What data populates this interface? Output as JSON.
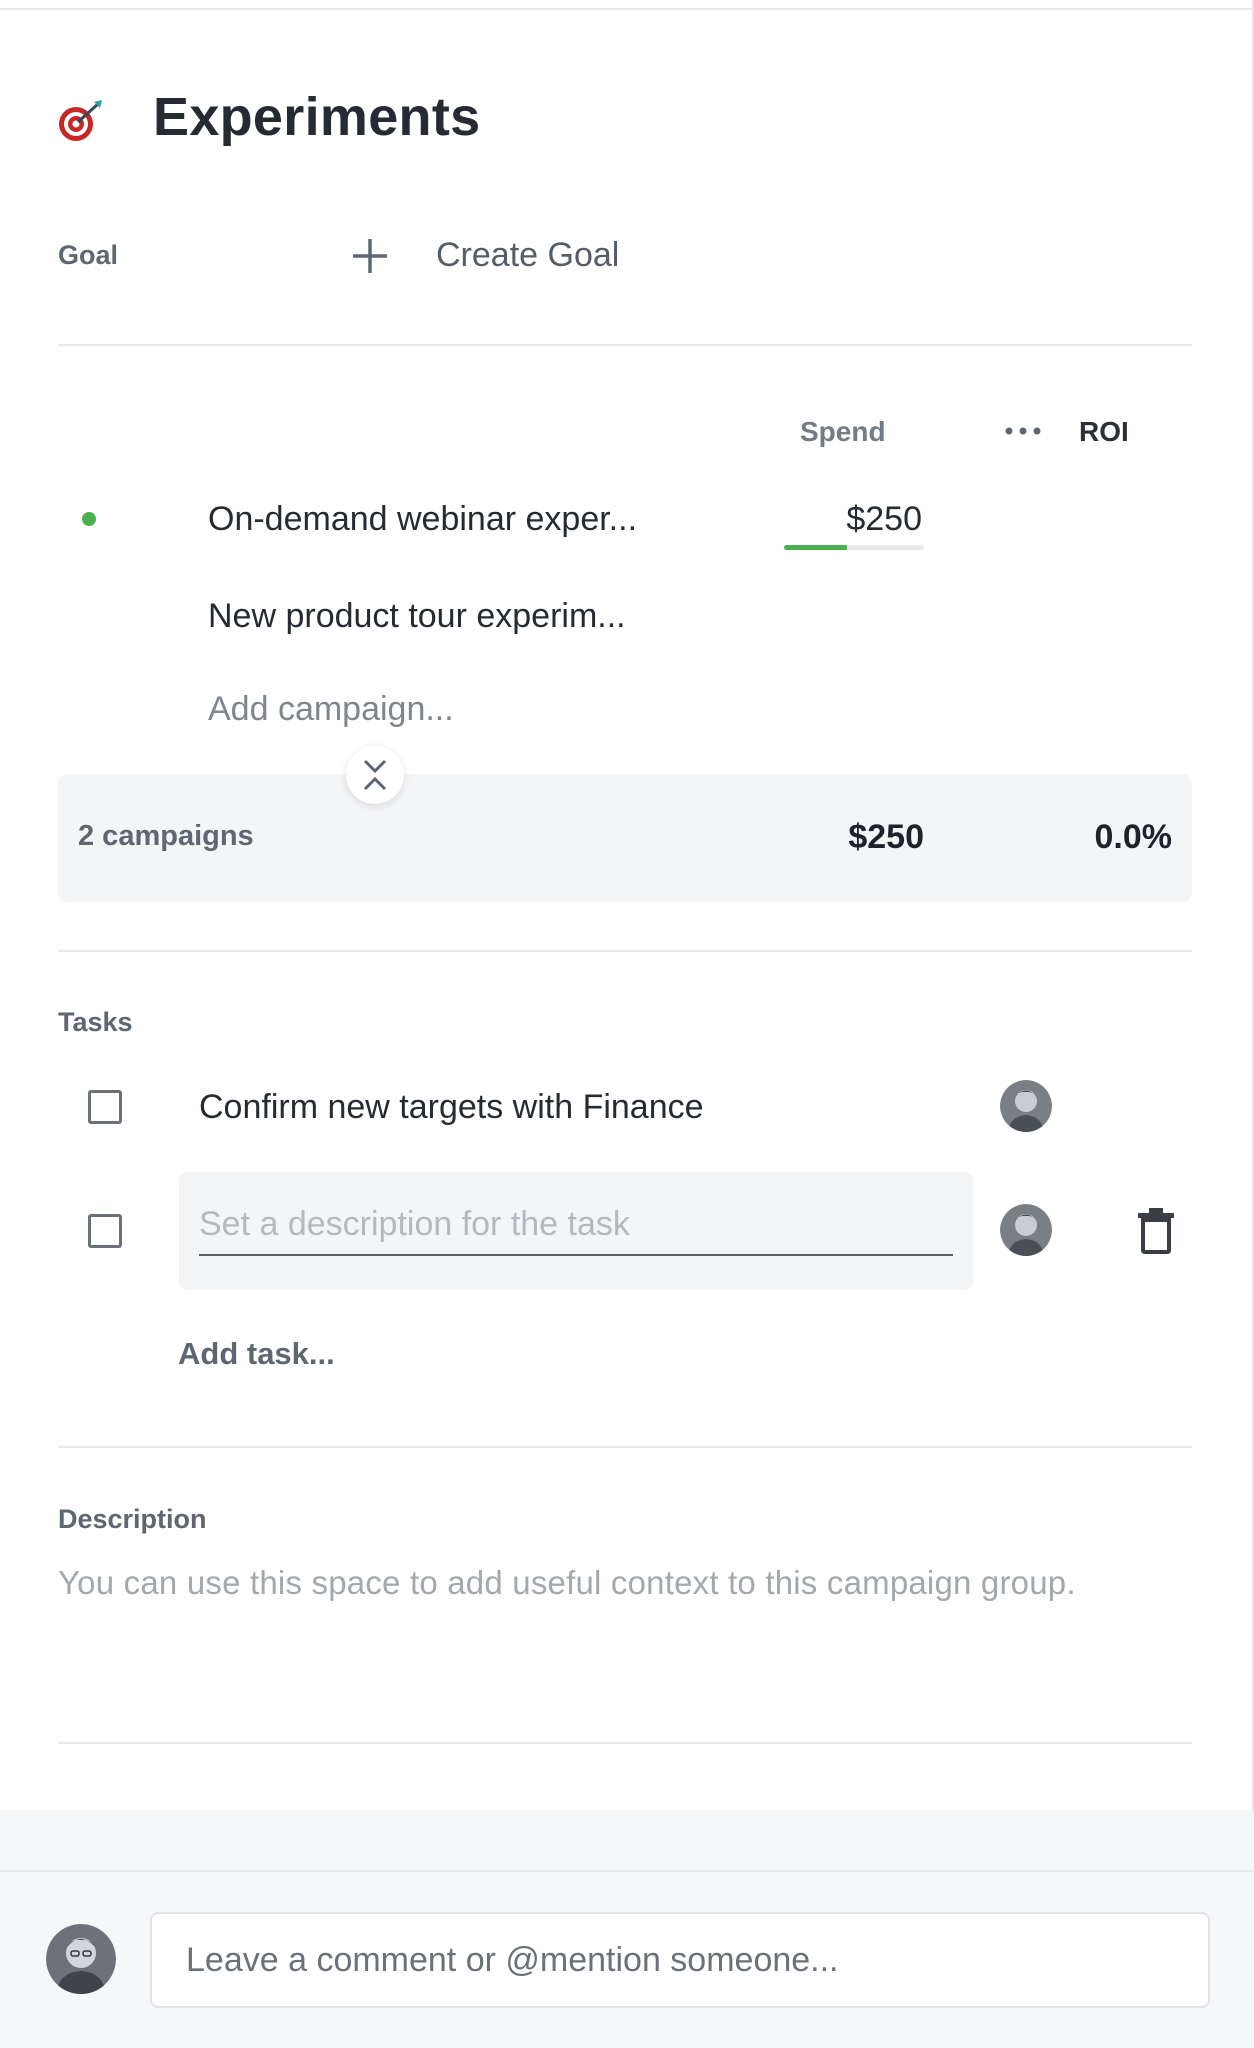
{
  "header": {
    "title": "Experiments",
    "icon": "target-dart-icon"
  },
  "goal": {
    "label": "Goal",
    "create_label": "Create Goal"
  },
  "campaigns": {
    "columns": {
      "spend": "Spend",
      "roi": "ROI"
    },
    "items": [
      {
        "name": "On-demand webinar exper...",
        "spend": "$250",
        "spend_fraction": 0.45,
        "status_color": "#4caf50"
      },
      {
        "name": "New product tour experim...",
        "spend": ""
      }
    ],
    "add_placeholder": "Add campaign...",
    "summary": {
      "count": "2 campaigns",
      "spend": "$250",
      "roi": "0.0%"
    }
  },
  "tasks": {
    "label": "Tasks",
    "items": [
      {
        "text": "Confirm new targets with Finance",
        "checked": false
      }
    ],
    "new_task_placeholder": "Set a description for the task",
    "add_label": "Add task..."
  },
  "description": {
    "label": "Description",
    "placeholder": "You can use this space to add useful context to this campaign group."
  },
  "comment": {
    "placeholder": "Leave a comment or @mention someone..."
  }
}
